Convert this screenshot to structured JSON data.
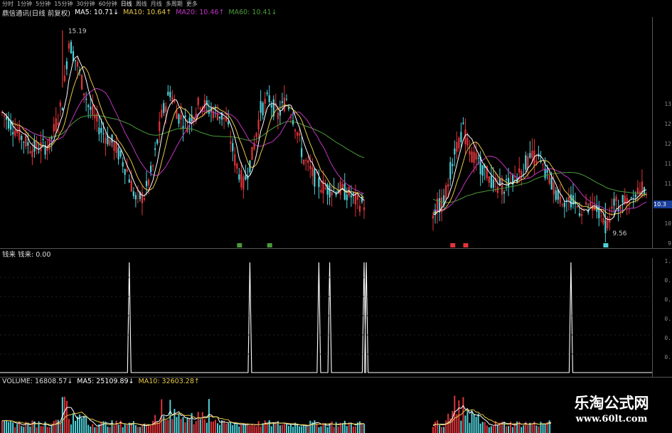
{
  "tabs": [
    "分时",
    "1分钟",
    "5分钟",
    "15分钟",
    "30分钟",
    "60分钟",
    "日线",
    "周线",
    "月线",
    "多周期",
    "更多"
  ],
  "active_tab": "日线",
  "legend": {
    "stock_name": "鼎信通讯(日线 前复权)",
    "ma5": "MA5: 10.71↓",
    "ma10": "MA10: 10.64↑",
    "ma20": "MA20: 10.46↑",
    "ma60": "MA60: 10.41↓"
  },
  "price_axis_ticks": [
    "13",
    "12",
    "12",
    "11",
    "11",
    "10",
    "10",
    "9"
  ],
  "current_price": "10.3",
  "high_label": "15.19",
  "low_label": "9.56",
  "indicator_legend": "钱来 钱来: 0.00",
  "indicator_axis_ticks": [
    "1.",
    "0.",
    "0.",
    "0.",
    "0.",
    "0."
  ],
  "volume_legend": {
    "volume": "VOLUME: 16808.57↓",
    "ma5": "MA5: 25109.89↓",
    "ma10": "MA10: 32603.28↑"
  },
  "watermark": {
    "title": "乐淘公式网",
    "url": "www.60lt.com"
  },
  "colors": {
    "up": "#e0343a",
    "down": "#4fd1d9",
    "ma5": "#ffffff",
    "ma10": "#e8c84a",
    "ma20": "#c036c0",
    "ma60": "#4a9a3a",
    "signal": "#ffffff",
    "axis": "#555555"
  },
  "chart_data": {
    "type": "candlestick",
    "price_high": 15.19,
    "price_low": 9.56,
    "indicator_spike_count": 7
  }
}
